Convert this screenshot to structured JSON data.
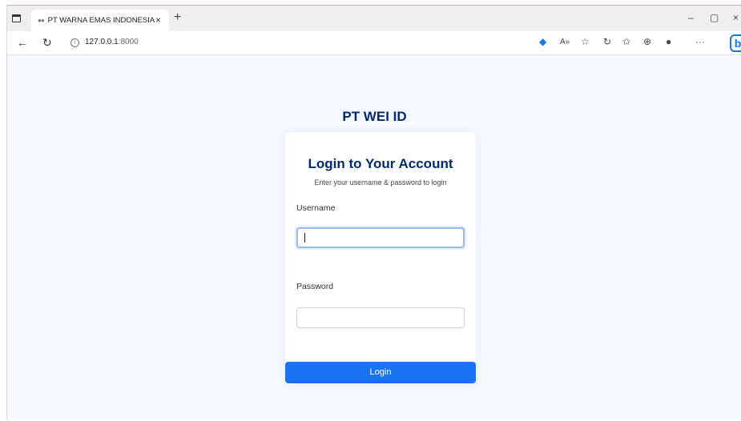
{
  "browser": {
    "tab_title": "PT WARNA EMAS INDONESIA",
    "tab_close": "×",
    "new_tab": "+",
    "url_host": "127.0.0.1",
    "url_port": ":8000",
    "minimize": "–",
    "maximize": "▢",
    "close": "×",
    "more": "···"
  },
  "page": {
    "brand": "PT WEI ID",
    "card_title": "Login to Your Account",
    "card_subtitle": "Enter your username & password to login",
    "username_label": "Username",
    "username_value": "",
    "password_label": "Password",
    "password_value": "",
    "login_button": "Login"
  },
  "colors": {
    "brand": "#012970",
    "button": "#1a73f3",
    "background": "#f6f9ff"
  }
}
